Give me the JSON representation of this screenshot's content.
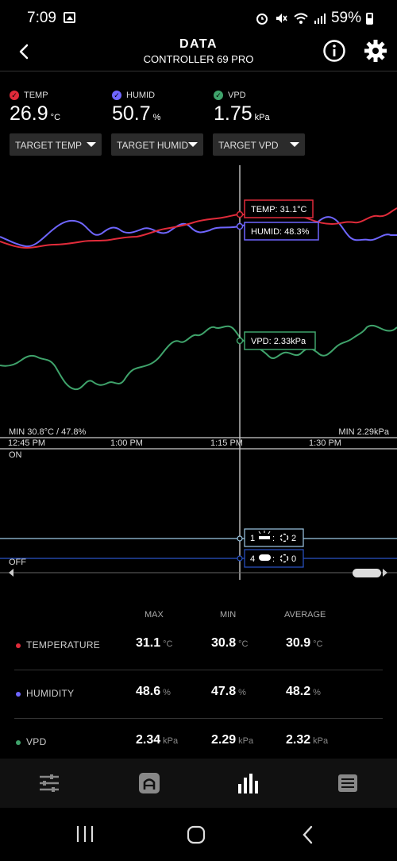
{
  "status": {
    "time": "7:09",
    "battery": "59%"
  },
  "header": {
    "title": "DATA",
    "subtitle": "CONTROLLER 69 PRO"
  },
  "readouts": [
    {
      "label": "TEMP",
      "value": "26.9",
      "unit": "°C",
      "color": "#e02b3a",
      "target": "TARGET TEMP"
    },
    {
      "label": "HUMID",
      "value": "50.7",
      "unit": "%",
      "color": "#6f66ff",
      "target": "TARGET HUMID"
    },
    {
      "label": "VPD",
      "value": "1.75",
      "unit": "kPa",
      "color": "#3fa36b",
      "target": "TARGET VPD"
    }
  ],
  "chart": {
    "temp_tooltip": "TEMP: 31.1°C",
    "humid_tooltip": "HUMID: 48.3%",
    "vpd_tooltip": "VPD: 2.33kPa",
    "min_left": "MIN 30.8°C / 47.8%",
    "min_right": "MIN 2.29kPa",
    "time_ticks": [
      "12:45 PM",
      "1:00 PM",
      "1:15 PM",
      "1:30 PM"
    ],
    "on_label": "ON",
    "off_label": "OFF",
    "device_one": "1",
    "device_one_count": "2",
    "device_four": "4",
    "device_four_count": "0"
  },
  "chart_data": {
    "type": "line",
    "x": [
      "12:45 PM",
      "1:00 PM",
      "1:15 PM",
      "1:30 PM"
    ],
    "series": [
      {
        "name": "TEMP",
        "color": "#e02b3a"
      },
      {
        "name": "HUMID",
        "color": "#6f66ff"
      },
      {
        "name": "VPD",
        "color": "#3fa36b"
      }
    ],
    "selected_point": {
      "time": "1:15 PM",
      "TEMP": 31.1,
      "HUMID": 48.3,
      "VPD": 2.33
    }
  },
  "stats": {
    "headers": [
      "MAX",
      "MIN",
      "AVERAGE"
    ],
    "rows": [
      {
        "name": "TEMPERATURE",
        "color": "#e02b3a",
        "max": "31.1",
        "min": "30.8",
        "avg": "30.9",
        "unit": "°C"
      },
      {
        "name": "HUMIDITY",
        "color": "#6f66ff",
        "max": "48.6",
        "min": "47.8",
        "avg": "48.2",
        "unit": "%"
      },
      {
        "name": "VPD",
        "color": "#3fa36b",
        "max": "2.34",
        "min": "2.29",
        "avg": "2.32",
        "unit": "kPa"
      }
    ]
  },
  "nav": [
    "sliders-icon",
    "controller-icon",
    "data-icon",
    "menu-icon"
  ]
}
